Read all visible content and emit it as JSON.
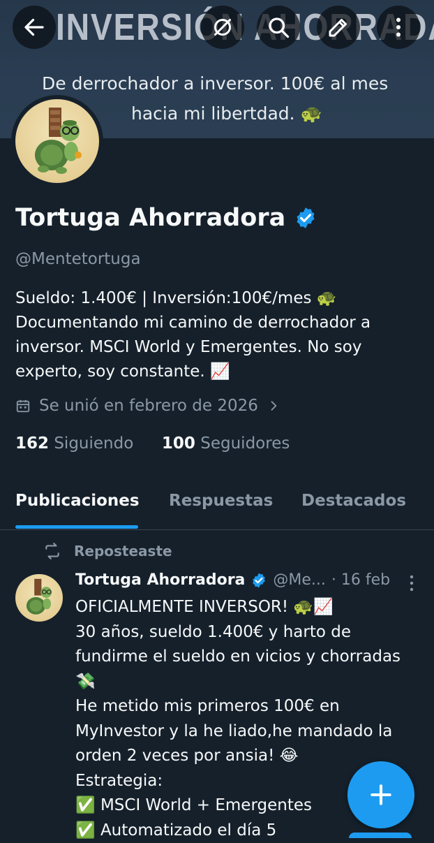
{
  "banner": {
    "title": "INVERSIÓN AHORRADA",
    "tagline_line1": "De derrochador a inversor. 100€ al mes",
    "tagline_line2": "hacia mi libertdad. 🐢"
  },
  "topbar": {
    "icons": [
      "back-arrow-icon",
      "grok-icon",
      "search-icon",
      "edit-icon",
      "more-vertical-icon"
    ]
  },
  "profile": {
    "name": "Tortuga Ahorradora",
    "handle": "@Mentetortuga",
    "bio": [
      "Sueldo: 1.400€ | Inversión:100€/mes 🐢",
      "Documentando mi camino de derrochador a",
      "inversor. MSCI World y Emergentes. No soy",
      "experto, soy constante. 📈"
    ],
    "joined": "Se unió en febrero de 2026",
    "following_count": "162",
    "following_label": "Siguiendo",
    "followers_count": "100",
    "followers_label": "Seguidores",
    "accent": "#1d9bf0"
  },
  "tabs": [
    {
      "label": "Publicaciones"
    },
    {
      "label": "Respuestas"
    },
    {
      "label": "Destacados"
    }
  ],
  "post": {
    "repost_label": "Reposteaste",
    "author": "Tortuga Ahorradora",
    "handle": "@Me...",
    "date": "· 16 feb",
    "lines": [
      "OFICIALMENTE INVERSOR! 🐢📈",
      "30 años,  sueldo 1.400€ y harto de",
      "fundirme el sueldo en vicios y chorradas",
      "💸",
      "He metido mis primeros 100€ en",
      "MyInvestor y la he liado,he mandado la",
      "orden 2 veces por ansia! 😂",
      "Estrategia:",
      "✅ MSCI World + Emergentes",
      "✅ Automatizado el día 5"
    ]
  }
}
